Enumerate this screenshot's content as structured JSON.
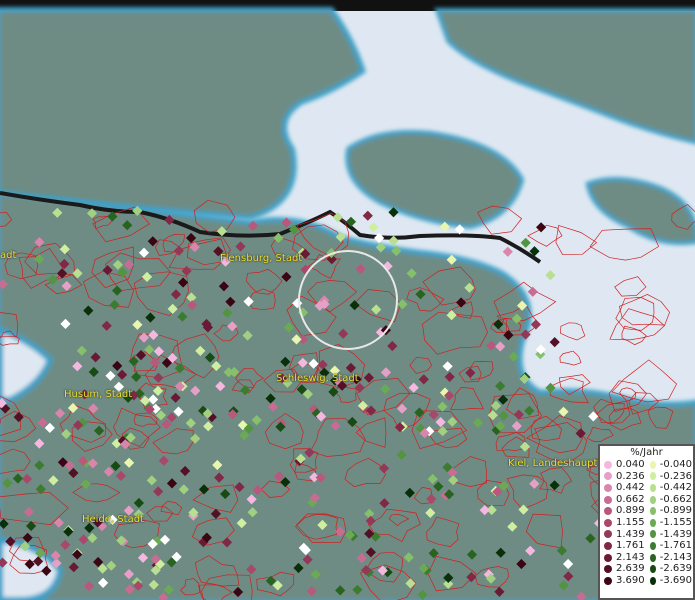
{
  "cities": [
    {
      "label": "Flensburg, Stadt"
    },
    {
      "label": "Schleswig, Stadt"
    },
    {
      "label": "Husum, Stadt"
    },
    {
      "label": "Heide, Stadt"
    },
    {
      "label": "Kiel, Landeshaupts"
    }
  ],
  "legend": {
    "title": "%/Jahr",
    "positive": [
      "0.040",
      "0.236",
      "0.442",
      "0.662",
      "0.899",
      "1.155",
      "1.439",
      "1.761",
      "2.143",
      "2.639",
      "3.690"
    ],
    "negative": [
      "-0.040",
      "-0.236",
      "-0.442",
      "-0.662",
      "-0.899",
      "-1.155",
      "-1.439",
      "-1.761",
      "-2.143",
      "-2.639",
      "-3.690"
    ],
    "positive_colors": [
      "#f4b8e0",
      "#e6a0c6",
      "#d986ac",
      "#c86c94",
      "#b8587c",
      "#a8486a",
      "#943858",
      "#802846",
      "#6a1a34",
      "#541024",
      "#3a0614"
    ],
    "negative_colors": [
      "#e8f6b0",
      "#d0eea0",
      "#b8e090",
      "#a0d080",
      "#86c06a",
      "#6aaa54",
      "#529440",
      "#3c7c30",
      "#286420",
      "#184a14",
      "#0a300a"
    ]
  }
}
